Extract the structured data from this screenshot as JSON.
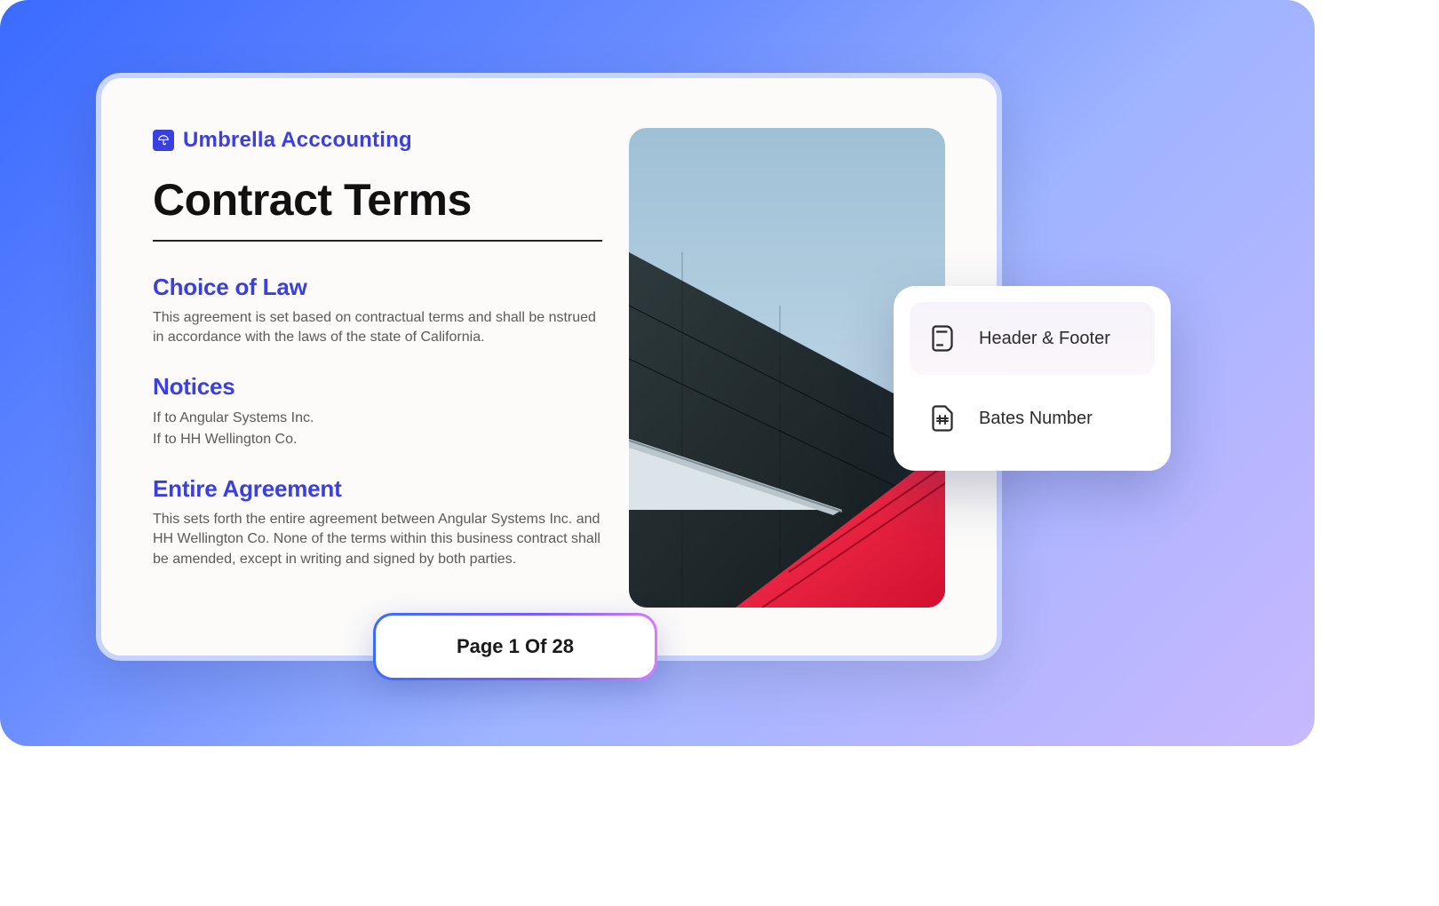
{
  "brand": {
    "name": "Umbrella Acccounting",
    "icon": "umbrella-icon"
  },
  "document": {
    "title": "Contract Terms",
    "sections": [
      {
        "heading": "Choice of Law",
        "body": "This agreement is set based on contractual terms and shall be nstrued in accordance with the laws of the state of California."
      },
      {
        "heading": "Notices",
        "lines": [
          "If to Angular Systems Inc.",
          "If to HH Wellington Co."
        ]
      },
      {
        "heading": "Entire Agreement",
        "body": "This sets forth the entire agreement between Angular Systems Inc. and HH Wellington Co. None of the terms within this business contract shall be amended, except in writing and signed by both parties."
      }
    ],
    "image_alt": "Architectural photo of dark and red building panels against sky"
  },
  "pager": {
    "label": "Page 1 Of 28",
    "current": 1,
    "total": 28
  },
  "side_panel": {
    "items": [
      {
        "label": "Header & Footer",
        "icon": "header-footer-icon",
        "active": true
      },
      {
        "label": "Bates Number",
        "icon": "bates-number-icon",
        "active": false
      }
    ]
  },
  "colors": {
    "accent": "#3a3fe0",
    "bg_gradient_start": "#3b6bff",
    "bg_gradient_end": "#c8b8ff"
  }
}
